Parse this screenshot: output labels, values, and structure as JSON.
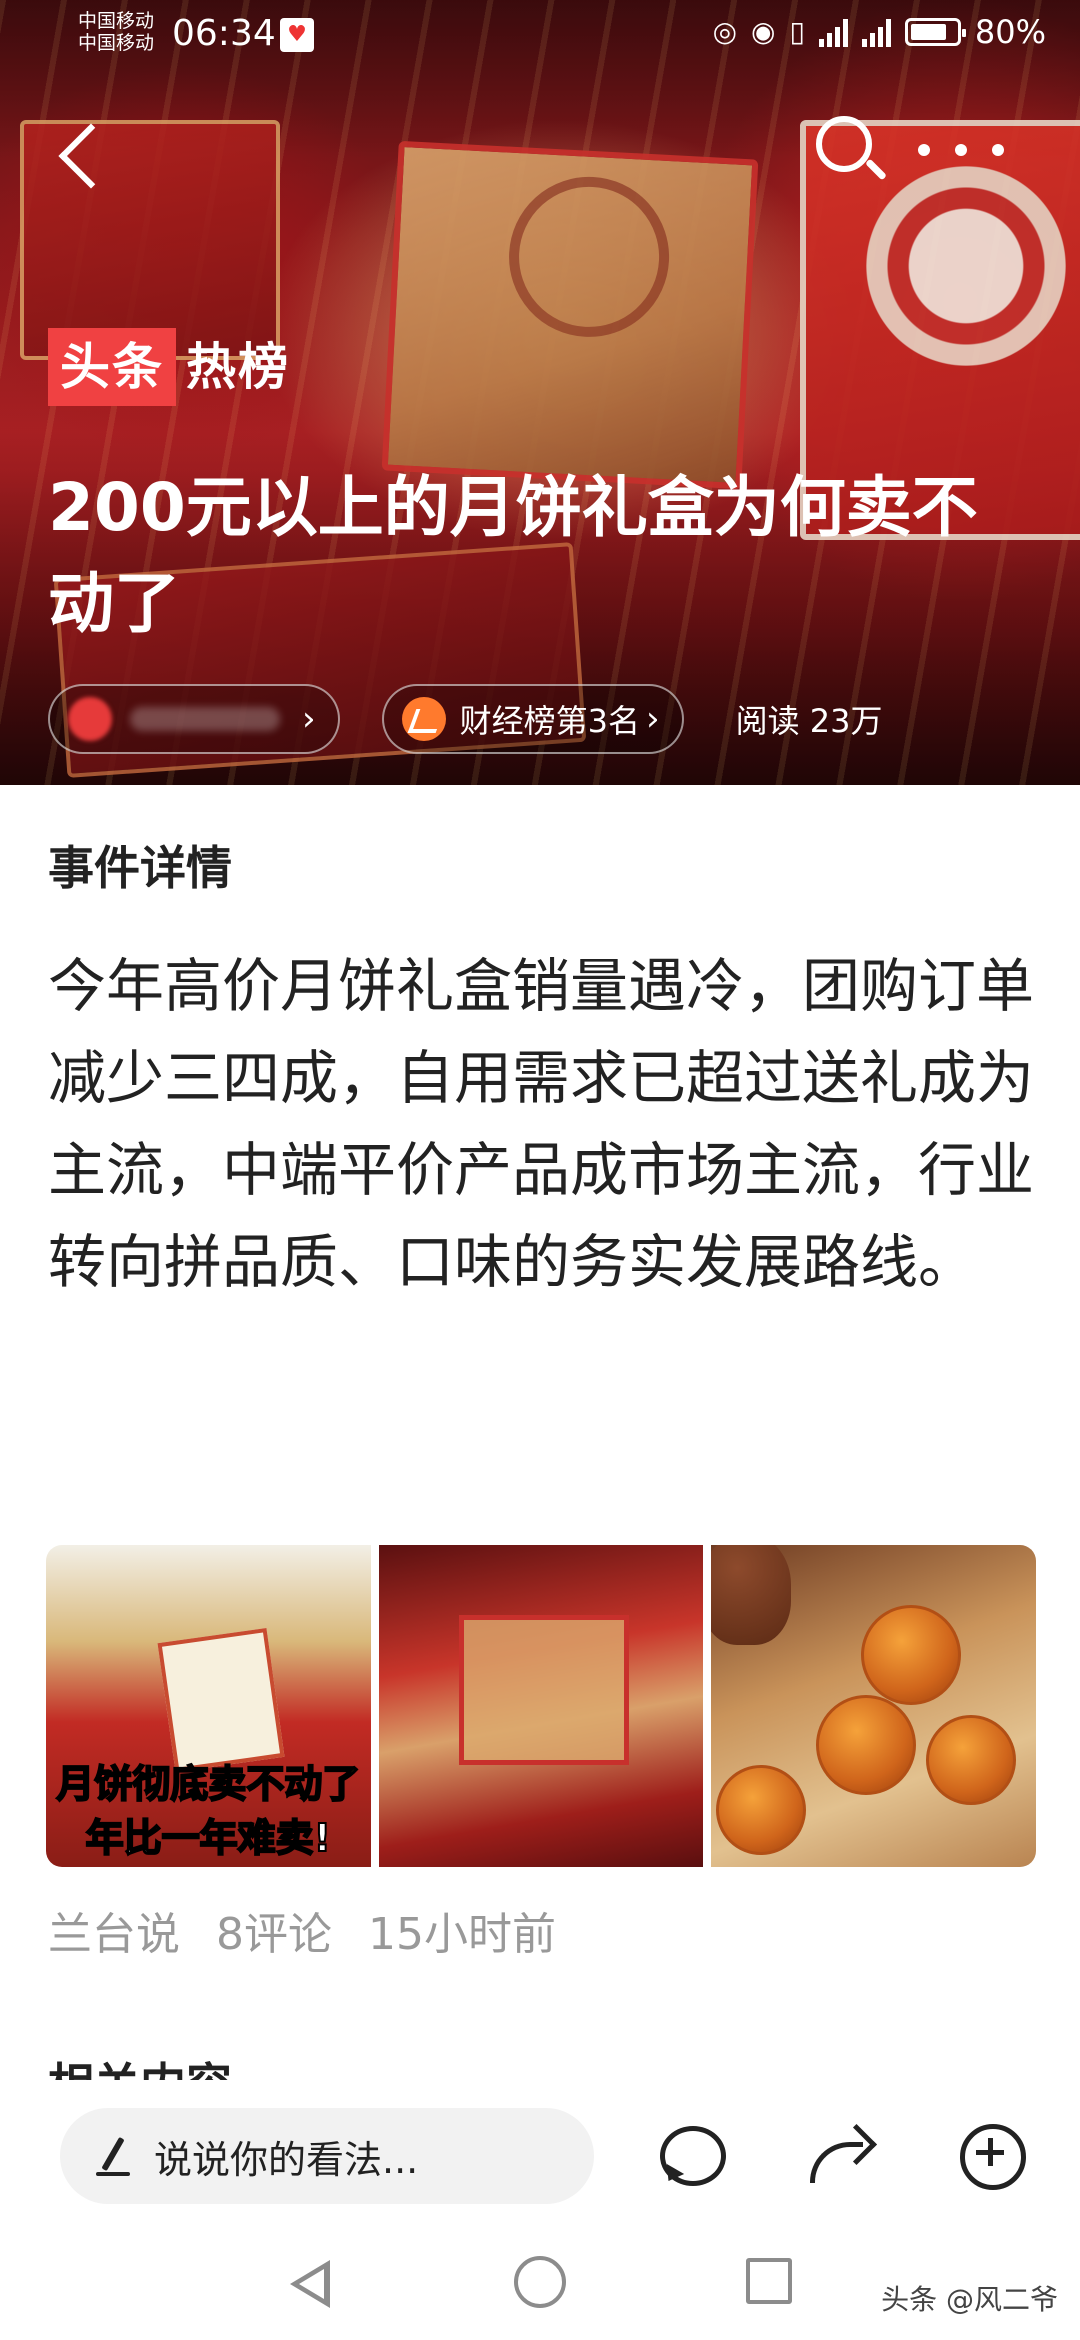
{
  "status_bar": {
    "carrier1": "中国移动",
    "carrier2": "中国移动",
    "time": "06:34",
    "battery_percent": "80%",
    "battery_level": 0.8
  },
  "nav": {
    "back_icon": "chevron-left-icon",
    "search_icon": "search-icon",
    "more_icon": "more-dots-icon"
  },
  "hero": {
    "badge_part1": "头条",
    "badge_part2": "热榜",
    "title": "200元以上的月饼礼盒为何卖不动了",
    "rank_label": "财经榜第3名",
    "rank_chevron": "›",
    "source_chevron": "›",
    "reads": "阅读 23万"
  },
  "article": {
    "section_title": "事件详情",
    "summary": "今年高价月饼礼盒销量遇冷，团购订单减少三四成，自用需求已超过送礼成为主流，中端平价产品成市场主流，行业转向拼品质、口味的务实发展路线。",
    "thumb1_caption1": "月饼彻底卖不动了",
    "thumb1_caption2": "年比一年难卖!",
    "author": "兰台说",
    "comments": "8评论",
    "time_ago": "15小时前",
    "next_section_title": "相关内容"
  },
  "comment_bar": {
    "placeholder": "说说你的看法...",
    "icons": [
      "comment-icon",
      "share-icon",
      "add-icon"
    ]
  },
  "system_nav": {
    "watermark": "头条 @风二爷"
  }
}
